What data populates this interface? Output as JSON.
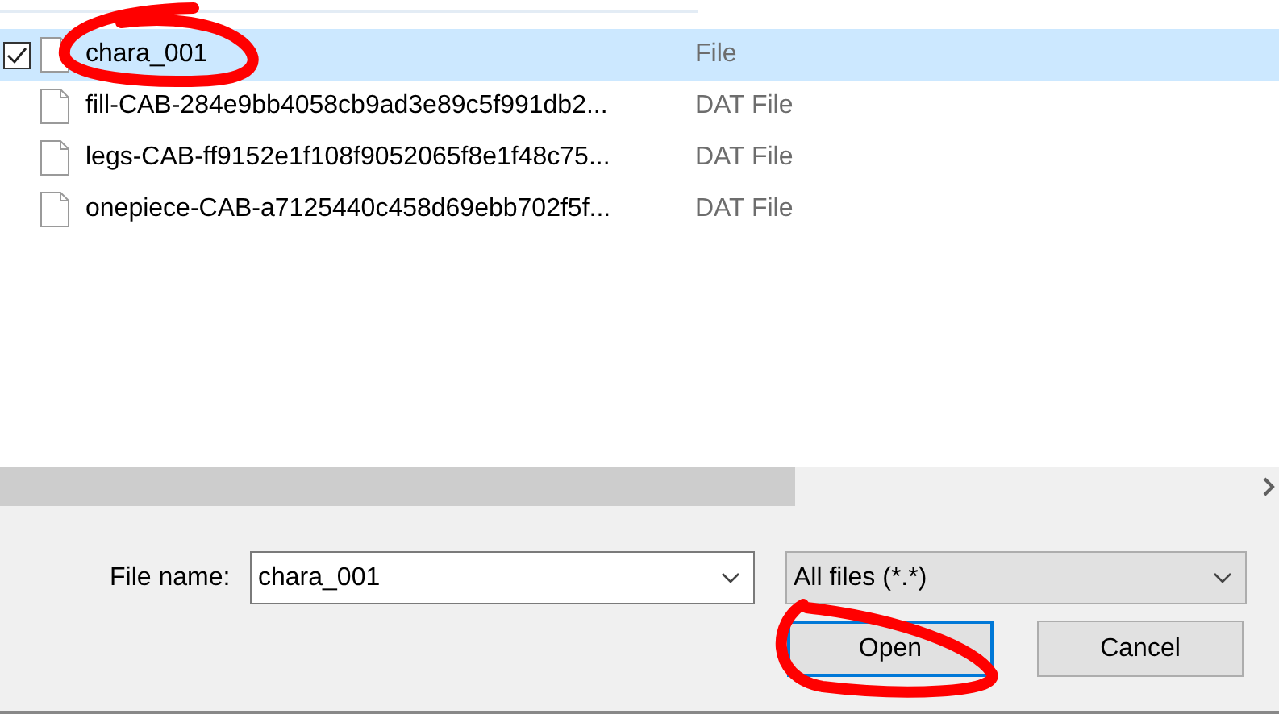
{
  "files": [
    {
      "name": "chara_001",
      "type": "File",
      "selected": true
    },
    {
      "name": "fill-CAB-284e9bb4058cb9ad3e89c5f991db2...",
      "type": "DAT File",
      "selected": false
    },
    {
      "name": "legs-CAB-ff9152e1f108f9052065f8e1f48c75...",
      "type": "DAT File",
      "selected": false
    },
    {
      "name": "onepiece-CAB-a7125440c458d69ebb702f5f...",
      "type": "DAT File",
      "selected": false
    }
  ],
  "file_name": {
    "label": "File name:",
    "value": "chara_001"
  },
  "filter": {
    "value": "All files (*.*)"
  },
  "buttons": [
    {
      "label": "Open",
      "kind": "default"
    },
    {
      "label": "Cancel",
      "kind": "normal"
    }
  ]
}
